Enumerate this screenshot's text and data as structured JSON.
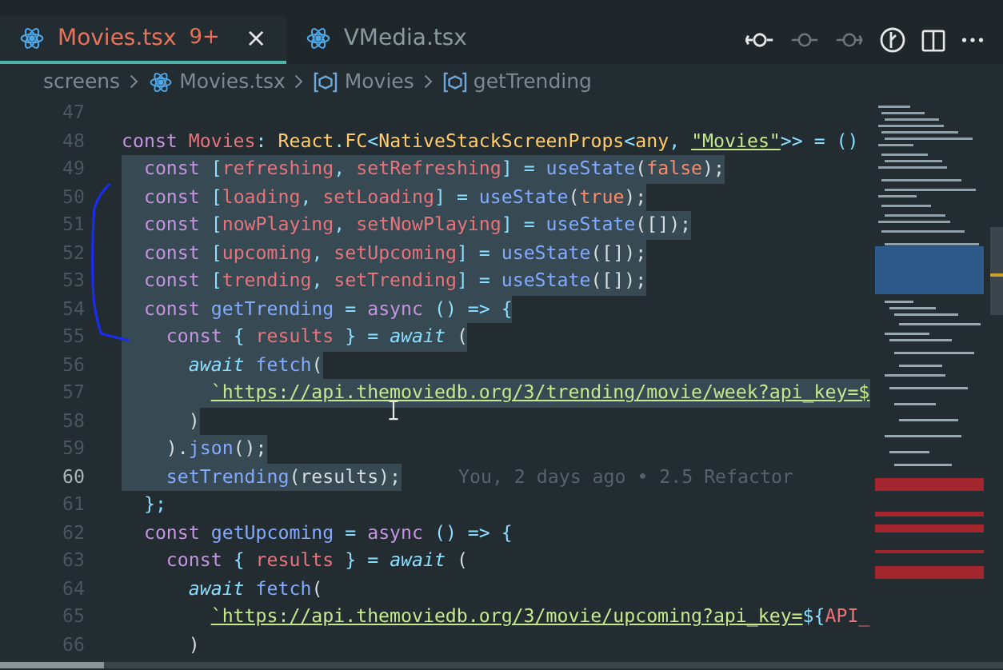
{
  "tabs": [
    {
      "label": "Movies.tsx",
      "badge": "9+",
      "close": "×",
      "selected": true,
      "errors": true
    },
    {
      "label": "VMedia.tsx",
      "selected": false,
      "errors": false
    }
  ],
  "breadcrumbs": [
    {
      "label": "screens",
      "kind": "folder"
    },
    {
      "label": "Movies.tsx",
      "kind": "file"
    },
    {
      "label": "Movies",
      "kind": "symbol"
    },
    {
      "label": "getTrending",
      "kind": "symbol"
    }
  ],
  "lines": [
    {
      "number": "47",
      "selected": false,
      "current": false
    },
    {
      "number": "48",
      "selected": false,
      "current": false,
      "tokens": [
        {
          "kind": "kw",
          "text": "const "
        },
        {
          "kind": "var",
          "text": "Movies"
        },
        {
          "kind": "punc",
          "text": ": "
        },
        {
          "kind": "type",
          "text": "React"
        },
        {
          "kind": "punc",
          "text": "."
        },
        {
          "kind": "type",
          "text": "FC"
        },
        {
          "kind": "punc",
          "text": "<"
        },
        {
          "kind": "type",
          "text": "NativeStackScreenProps"
        },
        {
          "kind": "punc",
          "text": "<"
        },
        {
          "kind": "type",
          "text": "any"
        },
        {
          "kind": "punc",
          "text": ", "
        },
        {
          "kind": "str",
          "text": "\"Movies\""
        },
        {
          "kind": "punc",
          "text": ">> = ()"
        }
      ]
    },
    {
      "number": "49",
      "selected": true,
      "current": false,
      "tokens": [
        {
          "kind": "kw",
          "text": "  const "
        },
        {
          "kind": "punc",
          "text": "["
        },
        {
          "kind": "var",
          "text": "refreshing"
        },
        {
          "kind": "punc",
          "text": ", "
        },
        {
          "kind": "var",
          "text": "setRefreshing"
        },
        {
          "kind": "punc",
          "text": "] = "
        },
        {
          "kind": "fn",
          "text": "useState"
        },
        {
          "kind": "plain",
          "text": "("
        },
        {
          "kind": "bool",
          "text": "false"
        },
        {
          "kind": "plain",
          "text": ");"
        }
      ]
    },
    {
      "number": "50",
      "selected": true,
      "current": false,
      "tokens": [
        {
          "kind": "kw",
          "text": "  const "
        },
        {
          "kind": "punc",
          "text": "["
        },
        {
          "kind": "var",
          "text": "loading"
        },
        {
          "kind": "punc",
          "text": ", "
        },
        {
          "kind": "var",
          "text": "setLoading"
        },
        {
          "kind": "punc",
          "text": "] = "
        },
        {
          "kind": "fn",
          "text": "useState"
        },
        {
          "kind": "plain",
          "text": "("
        },
        {
          "kind": "bool",
          "text": "true"
        },
        {
          "kind": "plain",
          "text": ");"
        }
      ]
    },
    {
      "number": "51",
      "selected": true,
      "current": false,
      "tokens": [
        {
          "kind": "kw",
          "text": "  const "
        },
        {
          "kind": "punc",
          "text": "["
        },
        {
          "kind": "var",
          "text": "nowPlaying"
        },
        {
          "kind": "punc",
          "text": ", "
        },
        {
          "kind": "var",
          "text": "setNowPlaying"
        },
        {
          "kind": "punc",
          "text": "] = "
        },
        {
          "kind": "fn",
          "text": "useState"
        },
        {
          "kind": "plain",
          "text": "([]);"
        }
      ]
    },
    {
      "number": "52",
      "selected": true,
      "current": false,
      "tokens": [
        {
          "kind": "kw",
          "text": "  const "
        },
        {
          "kind": "punc",
          "text": "["
        },
        {
          "kind": "var",
          "text": "upcoming"
        },
        {
          "kind": "punc",
          "text": ", "
        },
        {
          "kind": "var",
          "text": "setUpcoming"
        },
        {
          "kind": "punc",
          "text": "] = "
        },
        {
          "kind": "fn",
          "text": "useState"
        },
        {
          "kind": "plain",
          "text": "([]);"
        }
      ]
    },
    {
      "number": "53",
      "selected": true,
      "current": false,
      "tokens": [
        {
          "kind": "kw",
          "text": "  const "
        },
        {
          "kind": "punc",
          "text": "["
        },
        {
          "kind": "var",
          "text": "trending"
        },
        {
          "kind": "punc",
          "text": ", "
        },
        {
          "kind": "var",
          "text": "setTrending"
        },
        {
          "kind": "punc",
          "text": "] = "
        },
        {
          "kind": "fn",
          "text": "useState"
        },
        {
          "kind": "plain",
          "text": "([]);"
        }
      ]
    },
    {
      "number": "54",
      "selected": true,
      "current": false,
      "tokens": [
        {
          "kind": "kw",
          "text": "  const "
        },
        {
          "kind": "fn",
          "text": "getTrending"
        },
        {
          "kind": "punc",
          "text": " = "
        },
        {
          "kind": "kw",
          "text": "async"
        },
        {
          "kind": "punc",
          "text": " () => {"
        }
      ]
    },
    {
      "number": "55",
      "selected": true,
      "current": false,
      "tokens": [
        {
          "kind": "kw",
          "text": "    const "
        },
        {
          "kind": "punc",
          "text": "{ "
        },
        {
          "kind": "var",
          "text": "results"
        },
        {
          "kind": "punc",
          "text": " } = "
        },
        {
          "kind": "await",
          "text": "await"
        },
        {
          "kind": "plain",
          "text": " ("
        }
      ]
    },
    {
      "number": "56",
      "selected": true,
      "current": false,
      "tokens": [
        {
          "kind": "await",
          "text": "      await"
        },
        {
          "kind": "fn",
          "text": " fetch"
        },
        {
          "kind": "plain",
          "text": "("
        }
      ]
    },
    {
      "number": "57",
      "selected": true,
      "current": false,
      "tokens": [
        {
          "kind": "str",
          "text": "        `https://api.themoviedb.org/3/trending/movie/week?api_key=$"
        }
      ]
    },
    {
      "number": "58",
      "selected": true,
      "current": false,
      "tokens": [
        {
          "kind": "plain",
          "text": "      )"
        }
      ]
    },
    {
      "number": "59",
      "selected": true,
      "current": false,
      "tokens": [
        {
          "kind": "plain",
          "text": "    )."
        },
        {
          "kind": "fn",
          "text": "json"
        },
        {
          "kind": "plain",
          "text": "();"
        }
      ]
    },
    {
      "number": "60",
      "selected": true,
      "current": true,
      "blame": "You, 2 days ago • 2.5 Refactor",
      "tokens": [
        {
          "kind": "fn",
          "text": "    setTrending"
        },
        {
          "kind": "plain",
          "text": "(results);"
        }
      ]
    },
    {
      "number": "61",
      "selected": false,
      "current": false,
      "tokens": [
        {
          "kind": "punc",
          "text": "  };"
        }
      ]
    },
    {
      "number": "62",
      "selected": false,
      "current": false,
      "tokens": [
        {
          "kind": "kw",
          "text": "  const "
        },
        {
          "kind": "fn",
          "text": "getUpcoming"
        },
        {
          "kind": "punc",
          "text": " = "
        },
        {
          "kind": "kw",
          "text": "async"
        },
        {
          "kind": "punc",
          "text": " () => {"
        }
      ]
    },
    {
      "number": "63",
      "selected": false,
      "current": false,
      "tokens": [
        {
          "kind": "kw",
          "text": "    const "
        },
        {
          "kind": "punc",
          "text": "{ "
        },
        {
          "kind": "var",
          "text": "results"
        },
        {
          "kind": "punc",
          "text": " } = "
        },
        {
          "kind": "await",
          "text": "await"
        },
        {
          "kind": "plain",
          "text": " ("
        }
      ]
    },
    {
      "number": "64",
      "selected": false,
      "current": false,
      "tokens": [
        {
          "kind": "await",
          "text": "      await"
        },
        {
          "kind": "fn",
          "text": " fetch"
        },
        {
          "kind": "plain",
          "text": "("
        }
      ]
    },
    {
      "number": "65",
      "selected": false,
      "current": false,
      "tokens": [
        {
          "kind": "str",
          "text": "        `https://api.themoviedb.org/3/movie/upcoming?api_key="
        },
        {
          "kind": "punc",
          "text": "${"
        },
        {
          "kind": "var",
          "text": "API_"
        }
      ]
    },
    {
      "number": "66",
      "selected": false,
      "current": false,
      "tokens": [
        {
          "kind": "plain",
          "text": "      )"
        }
      ]
    }
  ]
}
